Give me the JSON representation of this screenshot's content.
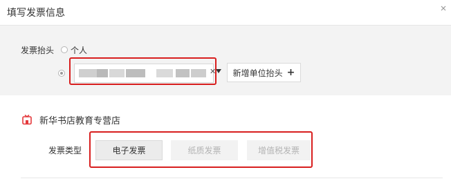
{
  "dialog": {
    "title": "填写发票信息",
    "close_icon": "close-icon"
  },
  "invoice_header": {
    "label": "发票抬头",
    "personal_option": "个人",
    "selected_option": "company",
    "company_input_value_obscured": true,
    "add_company_button": "新增单位抬头",
    "add_icon": "+"
  },
  "store": {
    "icon": "store-icon",
    "name": "新华书店教育专营店"
  },
  "invoice_type": {
    "label": "发票类型",
    "options": [
      {
        "label": "电子发票",
        "state": "selected"
      },
      {
        "label": "纸质发票",
        "state": "disabled"
      },
      {
        "label": "增值税发票",
        "state": "disabled"
      }
    ]
  },
  "colors": {
    "highlight": "#d81e1e",
    "section_bg": "#f3f3f3",
    "store_icon": "#e4393c"
  }
}
